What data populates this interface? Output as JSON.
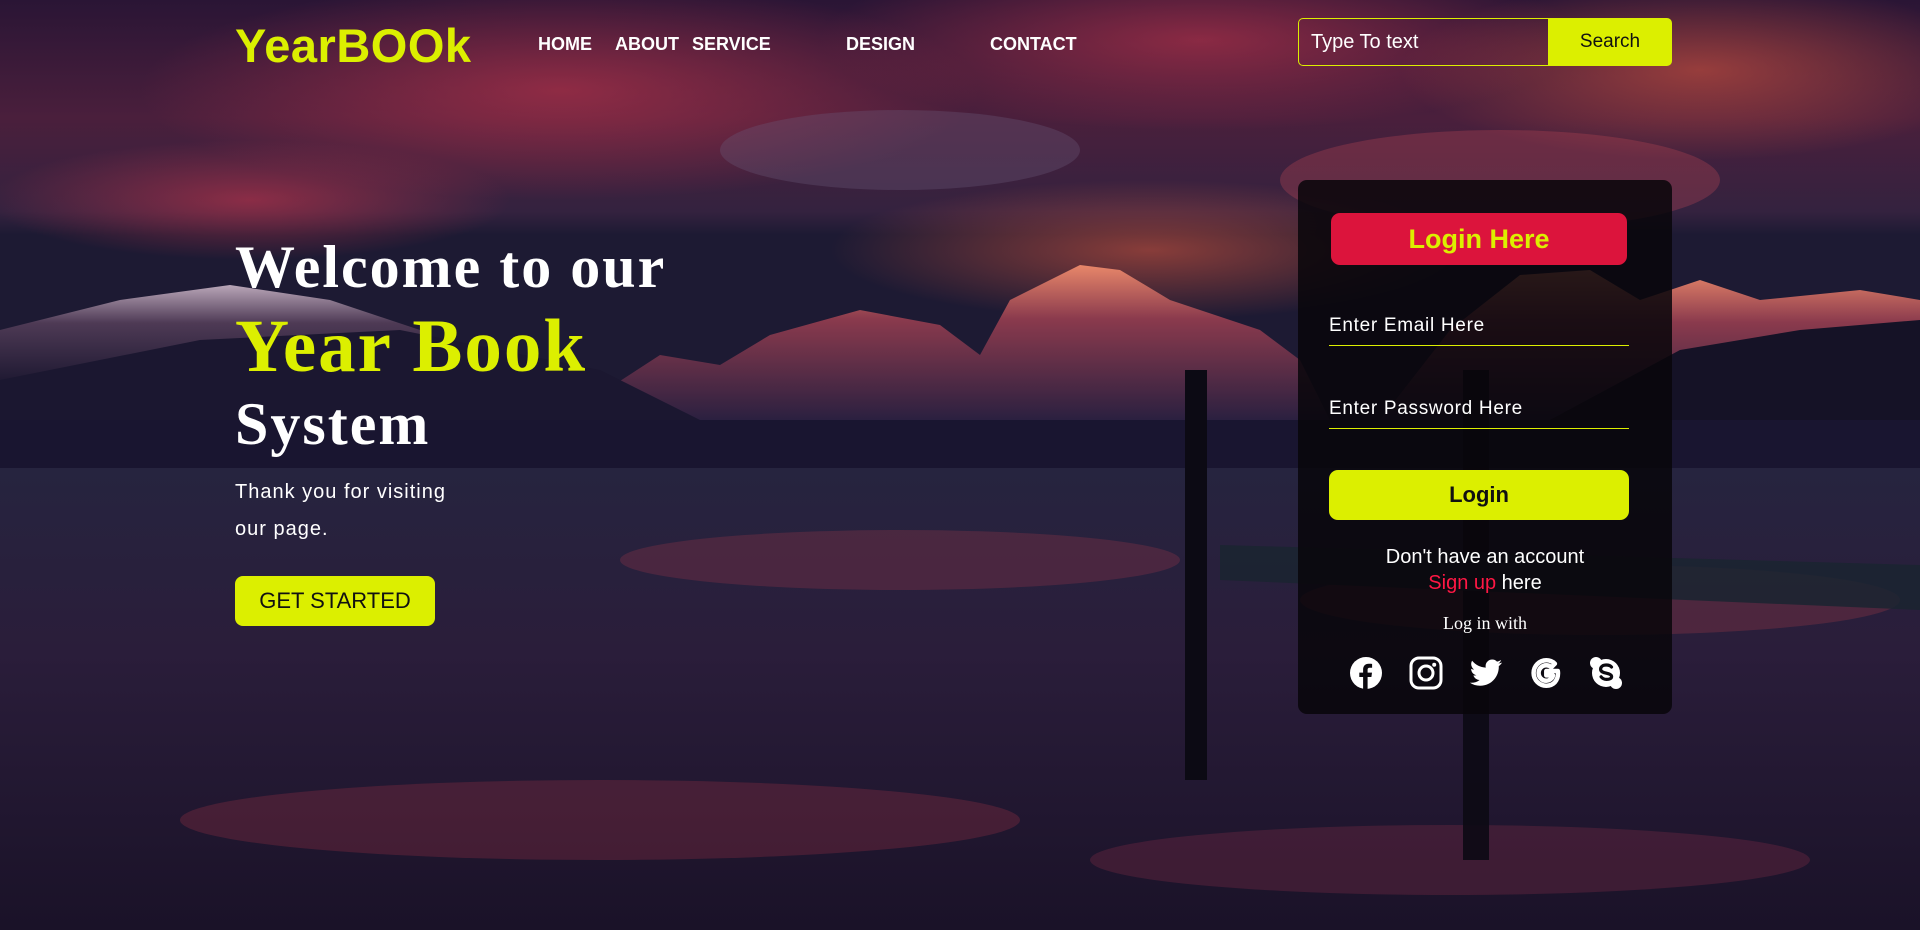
{
  "brand": {
    "logo": "YearBOOk"
  },
  "nav": {
    "items": [
      "HOME",
      "ABOUT",
      "SERVICE",
      "DESIGN",
      "CONTACT"
    ]
  },
  "search": {
    "placeholder": "Type To text",
    "button_label": "Search"
  },
  "hero": {
    "line1": "Welcome to our",
    "line2": "Year Book",
    "line3": "System",
    "tagline": "Thank you for visiting our page.",
    "cta_label": "GET STARTED"
  },
  "login": {
    "title": "Login Here",
    "email_placeholder": "Enter Email Here",
    "password_placeholder": "Enter Password Here",
    "button_label": "Login",
    "no_account_text": "Don't have an account",
    "signup_link": "Sign up",
    "signup_suffix": " here",
    "login_with": "Log in with",
    "social_icons": [
      "facebook-icon",
      "instagram-icon",
      "twitter-icon",
      "google-icon",
      "skype-icon"
    ]
  },
  "colors": {
    "accent": "#dcef00",
    "login_title_bg": "#dc143c",
    "signup_link": "#ff1744"
  }
}
